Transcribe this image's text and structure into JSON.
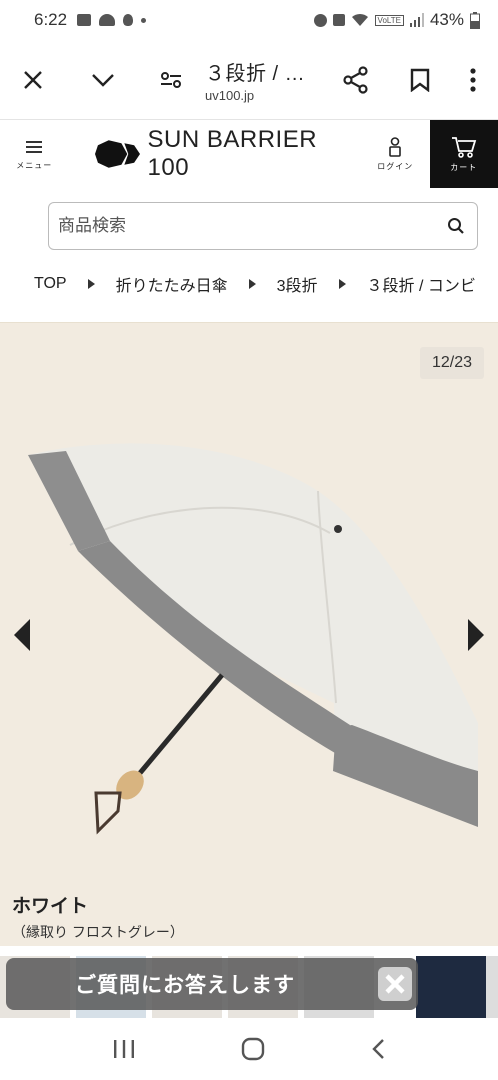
{
  "status_bar": {
    "time": "6:22",
    "battery": "43%",
    "signal_label": "VoLTE"
  },
  "browser": {
    "title": "３段折 / …",
    "url": "uv100.jp"
  },
  "site": {
    "menu_label": "メニュー",
    "logo_text": "SUN BARRIER 100",
    "login_label": "ログイン",
    "cart_label": "カート"
  },
  "search": {
    "placeholder": "商品検索"
  },
  "breadcrumb": [
    "TOP",
    "折りたたみ日傘",
    "3段折",
    "３段折 / コンビ"
  ],
  "gallery": {
    "counter": "12/23",
    "color_name": "ホワイト",
    "color_detail": "（縁取り フロストグレー）"
  },
  "chat_banner": {
    "label": "ご質問にお答えします"
  },
  "colors": {
    "cart_bg": "#111111",
    "gallery_bg": "#f2ebe0",
    "border_gray": "#8a8a8a"
  }
}
